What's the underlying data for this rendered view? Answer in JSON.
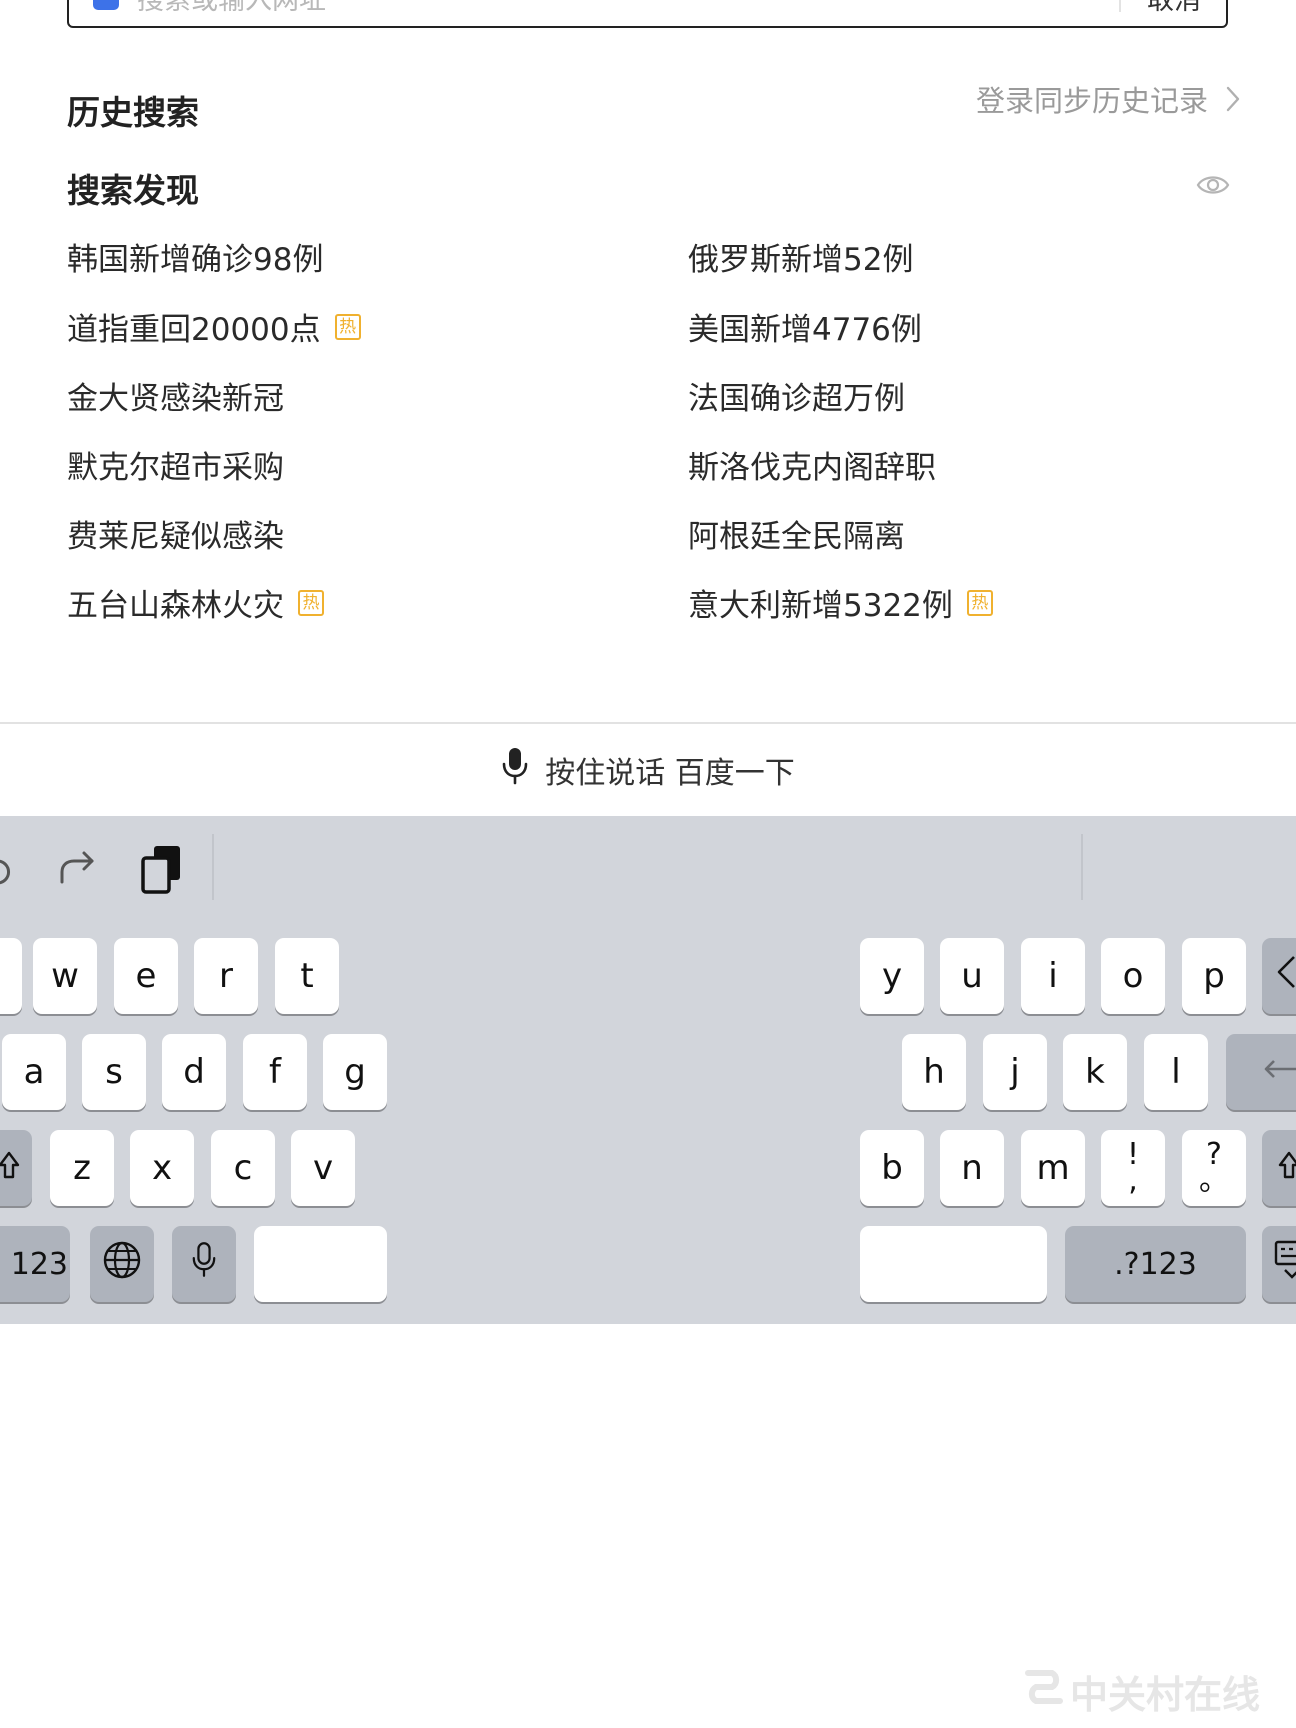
{
  "search": {
    "placeholder": "搜索或输入网址",
    "cancel_label": "取消"
  },
  "history": {
    "title": "历史搜索",
    "sync_link": "登录同步历史记录"
  },
  "discover": {
    "title": "搜索发现",
    "hot_label": "热",
    "items": [
      {
        "text": "韩国新增确诊98例",
        "hot": false
      },
      {
        "text": "俄罗斯新增52例",
        "hot": false
      },
      {
        "text": "道指重回20000点",
        "hot": true
      },
      {
        "text": "美国新增4776例",
        "hot": false
      },
      {
        "text": "金大贤感染新冠",
        "hot": false
      },
      {
        "text": "法国确诊超万例",
        "hot": false
      },
      {
        "text": "默克尔超市采购",
        "hot": false
      },
      {
        "text": "斯洛伐克内阁辞职",
        "hot": false
      },
      {
        "text": "费莱尼疑似感染",
        "hot": false
      },
      {
        "text": "阿根廷全民隔离",
        "hot": false
      },
      {
        "text": "五台山森林火灾",
        "hot": true
      },
      {
        "text": "意大利新增5322例",
        "hot": true
      }
    ]
  },
  "voice": {
    "label": "按住说话 百度一下"
  },
  "keyboard": {
    "left_rows": [
      [
        "w",
        "e",
        "r",
        "t"
      ],
      [
        "a",
        "s",
        "d",
        "f",
        "g"
      ],
      [
        "z",
        "x",
        "c",
        "v"
      ]
    ],
    "right_rows": [
      [
        "y",
        "u",
        "i",
        "o",
        "p"
      ],
      [
        "h",
        "j",
        "k",
        "l"
      ],
      [
        "b",
        "n",
        "m"
      ]
    ],
    "punct_1": {
      "top": "!",
      "bottom": ","
    },
    "punct_2": {
      "top": "?",
      "bottom": "。"
    },
    "numbers_left_label": "123",
    "numbers_right_label": ".?123"
  },
  "watermark": {
    "text": "中关村在线"
  },
  "colors": {
    "hot_badge": "#f0b12f",
    "keyboard_bg": "#d2d5db",
    "logo_blue": "#3d72e8"
  }
}
